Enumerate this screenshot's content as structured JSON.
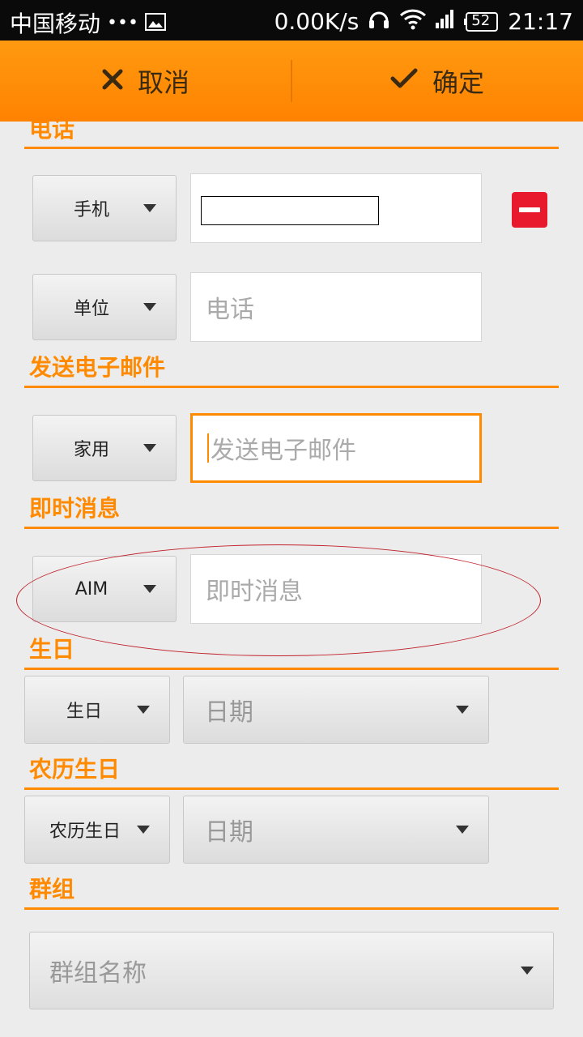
{
  "status_bar": {
    "carrier": "中国移动",
    "dots": "•••",
    "speed": "0.00K/s",
    "battery": "52",
    "time": "21:17"
  },
  "action_bar": {
    "cancel_label": "取消",
    "confirm_label": "确定"
  },
  "sections": {
    "phone": {
      "title": "电话",
      "rows": [
        {
          "type": "手机",
          "value": ""
        },
        {
          "type": "单位",
          "placeholder": "电话"
        }
      ]
    },
    "email": {
      "title": "发送电子邮件",
      "rows": [
        {
          "type": "家用",
          "placeholder": "发送电子邮件"
        }
      ]
    },
    "im": {
      "title": "即时消息",
      "rows": [
        {
          "type": "AIM",
          "placeholder": "即时消息"
        }
      ]
    },
    "birthday": {
      "title": "生日",
      "type": "生日",
      "date_placeholder": "日期"
    },
    "lunar_birthday": {
      "title": "农历生日",
      "type": "农历生日",
      "date_placeholder": "日期"
    },
    "group": {
      "title": "群组",
      "placeholder": "群组名称"
    }
  },
  "colors": {
    "accent": "#ff8a00",
    "remove": "#e8192c",
    "annotation": "#c0202a"
  }
}
